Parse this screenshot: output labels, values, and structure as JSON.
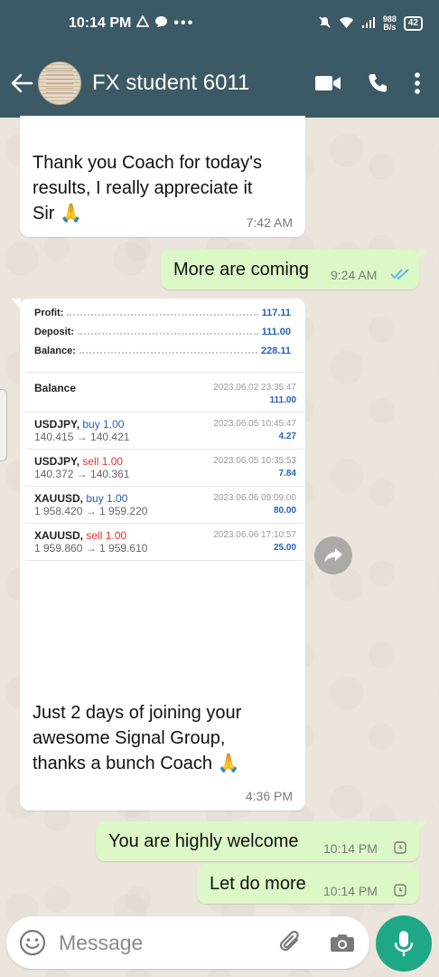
{
  "status_bar": {
    "time": "10:14 PM",
    "net_speed_value": "988",
    "net_speed_unit": "B/s",
    "battery": "42"
  },
  "header": {
    "contact_name": "FX student 6011"
  },
  "messages": [
    {
      "direction": "in",
      "text_lines": [
        "Thank you Coach for today's",
        "results, I really appreciate it",
        "Sir"
      ],
      "emoji": "🙏",
      "time": "7:42 AM"
    },
    {
      "direction": "out",
      "text": "More are coming",
      "time": "9:24 AM",
      "status": "read"
    },
    {
      "direction": "in",
      "text_lines": [
        "Just 2 days of joining your",
        "awesome Signal Group,",
        "thanks a bunch Coach"
      ],
      "emoji": "🙏",
      "time": "4:36 PM"
    },
    {
      "direction": "out",
      "text": "You are highly welcome",
      "time": "10:14 PM",
      "status": "pending"
    },
    {
      "direction": "out",
      "text": "Let do more",
      "time": "10:14 PM",
      "status": "pending"
    }
  ],
  "report": {
    "summary": [
      {
        "label": "Profit:",
        "value": "117.11"
      },
      {
        "label": "Deposit:",
        "value": "111.00"
      },
      {
        "label": "Balance:",
        "value": "228.11"
      }
    ],
    "balance_row": {
      "label": "Balance",
      "date": "2023.06.02 23:35:47",
      "value": "111.00"
    },
    "deals": [
      {
        "symbol": "USDJPY,",
        "side": "buy 1.00",
        "prices": "140.415 → 140.421",
        "date": "2023.06.05 10:45:47",
        "profit": "4.27",
        "side_type": "buy"
      },
      {
        "symbol": "USDJPY,",
        "side": "sell 1.00",
        "prices": "140.372 → 140.361",
        "date": "2023.06.05 10:35:53",
        "profit": "7.84",
        "side_type": "sell"
      },
      {
        "symbol": "XAUUSD,",
        "side": "buy 1.00",
        "prices": "1 958.420 → 1 959.220",
        "date": "2023.06.06 09:09:00",
        "profit": "80.00",
        "side_type": "buy"
      },
      {
        "symbol": "XAUUSD,",
        "side": "sell 1.00",
        "prices": "1 959.860 → 1 959.610",
        "date": "2023.06.06 17:10:57",
        "profit": "25.00",
        "side_type": "sell"
      }
    ]
  },
  "composer": {
    "placeholder": "Message"
  },
  "colors": {
    "header": "#3c5a66",
    "outgoing_bubble": "#dcf8c6",
    "incoming_bubble": "#ffffff",
    "mic_button": "#1fa885",
    "read_tick": "#4fb6ec",
    "report_value": "#2563b8",
    "sell": "#dd3333"
  },
  "icons": [
    "back-arrow-icon",
    "video-call-icon",
    "phone-icon",
    "more-vert-icon",
    "forward-icon",
    "emoji-icon",
    "attach-icon",
    "camera-icon",
    "mic-icon",
    "double-check-icon",
    "clock-icon"
  ]
}
